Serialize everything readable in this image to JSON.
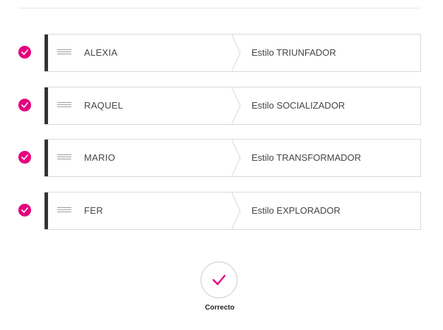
{
  "colors": {
    "accent": "#e5007e",
    "card_accent": "#333333",
    "border": "#d9d9d9"
  },
  "rows": [
    {
      "name": "ALEXIA",
      "style": "Estilo TRIUNFADOR",
      "status_icon": "check-circle-icon"
    },
    {
      "name": "RAQUEL",
      "style": "Estilo SOCIALIZADOR",
      "status_icon": "check-circle-icon"
    },
    {
      "name": "MARIO",
      "style": "Estilo TRANSFORMADOR",
      "status_icon": "check-circle-icon"
    },
    {
      "name": "FER",
      "style": "Estilo EXPLORADOR",
      "status_icon": "check-circle-icon"
    }
  ],
  "result": {
    "icon": "check-icon",
    "label": "Correcto"
  }
}
